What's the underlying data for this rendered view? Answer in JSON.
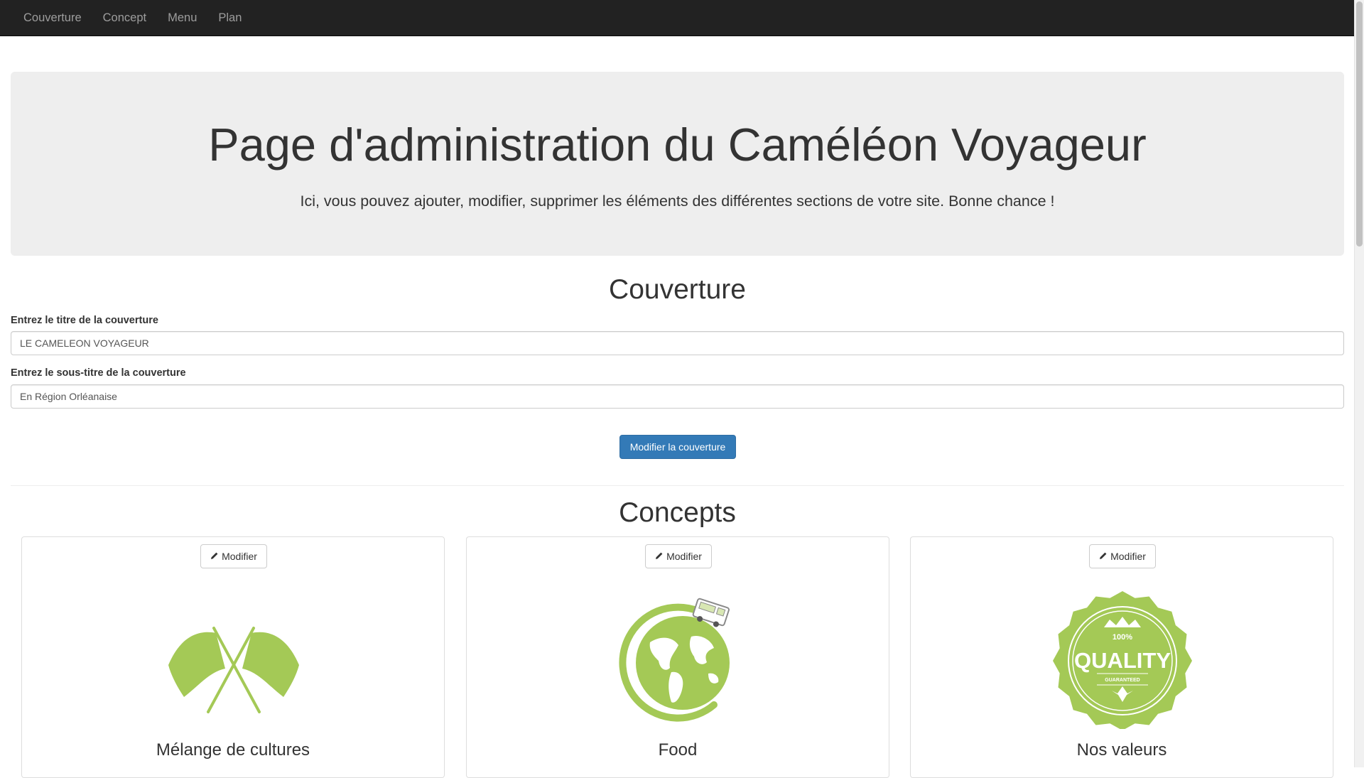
{
  "navbar": {
    "links": [
      "Couverture",
      "Concept",
      "Menu",
      "Plan"
    ]
  },
  "jumbotron": {
    "title": "Page d'administration du Caméléon Voyageur",
    "lead": "Ici, vous pouvez ajouter, modifier, supprimer les éléments des différentes sections de votre site. Bonne chance !"
  },
  "couverture": {
    "heading": "Couverture",
    "title_label": "Entrez le titre de la couverture",
    "title_value": "LE CAMELEON VOYAGEUR",
    "subtitle_label": "Entrez le sous-titre de la couverture",
    "subtitle_value": "En Région Orléanaise",
    "submit_label": "Modifier la couverture"
  },
  "concepts": {
    "heading": "Concepts",
    "edit_label": "Modifier",
    "cards": [
      {
        "title": "Mélange de cultures",
        "icon": "crossed-flags-icon"
      },
      {
        "title": "Food",
        "icon": "globe-foodtruck-icon"
      },
      {
        "title": "Nos valeurs",
        "icon": "quality-seal-icon"
      }
    ],
    "seal_text": {
      "top": "100%",
      "main": "QUALITY",
      "bottom": "GUARANTEED"
    }
  },
  "colors": {
    "navbar_bg": "#222222",
    "accent_green": "#a4c956",
    "primary_blue": "#337ab7"
  }
}
